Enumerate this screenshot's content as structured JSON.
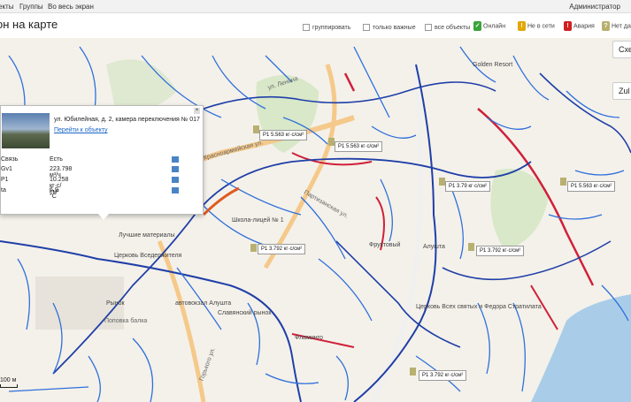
{
  "topbar": {
    "nav": [
      "екты",
      "Группы",
      "Во весь экран"
    ],
    "user": "Администратор"
  },
  "page_title": "он на карте",
  "filters": {
    "group": "группировать",
    "important": "только важные",
    "all": "все объекты"
  },
  "legend": [
    {
      "label": "Онлайн",
      "color": "#3aa33a"
    },
    {
      "label": "Не в сети",
      "color": "#e0a800"
    },
    {
      "label": "Авария",
      "color": "#d02020"
    },
    {
      "label": "Нет да",
      "color": "#b8b070"
    }
  ],
  "map": {
    "btn_scheme": "Схе",
    "btn_zoom": "Zul",
    "pois": [
      "Golden Resort",
      "Школа-лицей № 1",
      "Лучшие материалы",
      "Церковь Вседержителя",
      "Фруктовый",
      "Алушта",
      "Славянский рынок",
      "автовокзал Алушта",
      "Рынок",
      "Церковь Всех святых и Федора Стратилата",
      "Фламинго"
    ],
    "streets": [
      "Красноармейская ул.",
      "ул. Ленина",
      "Партизанская ул.",
      "Горького ул.",
      "Поповка балка"
    ],
    "readouts": [
      "P1 5.563 кг·с/см²",
      "P1 5.563 кг·с/см²",
      "P1 3.79 кг·с/см²",
      "P1 5.563 кг·с/см²",
      "P1 3.792 кг·с/см²",
      "P1 3.792 кг·с/см²",
      "P1 3.792 кг·с/см²"
    ],
    "scale": "100 м"
  },
  "popup": {
    "title": "ул. Юбилейная, д. 2, камера переключения № 017",
    "link": "Перейти к объекту",
    "rows": [
      {
        "label": "Связь",
        "value": "Есть"
      },
      {
        "label": "Gv1",
        "value": "223.798 м³/ч"
      },
      {
        "label": "P1",
        "value": "10.258 кг·с/см²"
      },
      {
        "label": "ta",
        "value": "6.9 °C"
      }
    ]
  }
}
